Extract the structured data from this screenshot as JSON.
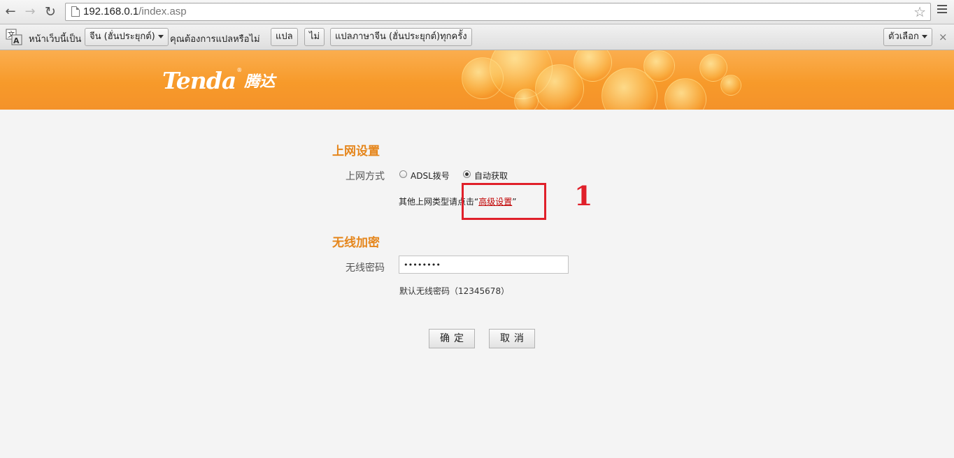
{
  "browser": {
    "url_host": "192.168.0.1",
    "url_path": "/index.asp",
    "icons": {
      "back": "back-arrow-icon",
      "forward": "forward-arrow-icon",
      "reload": "reload-icon",
      "bookmark": "star-icon",
      "menu": "menu-icon"
    }
  },
  "translate_bar": {
    "prefix": "หน้าเว็บนี้เป็น",
    "language_select": "จีน (ฮั่นประยุกต์)",
    "question": "คุณต้องการแปลหรือไม่",
    "translate_button": "แปล",
    "no_button": "ไม่",
    "always_button": "แปลภาษาจีน (ฮั่นประยุกต์)ทุกครั้ง",
    "options_button": "ตัวเลือก",
    "close_icon": "×"
  },
  "banner": {
    "brand_en": "Tenda",
    "brand_reg": "®",
    "brand_cn": "腾达",
    "colors": {
      "primary": "#f79a2a",
      "highlight": "#fbae4f"
    }
  },
  "internet": {
    "title": "上网设置",
    "mode_label": "上网方式",
    "options": [
      {
        "label": "ADSL拨号",
        "selected": false
      },
      {
        "label": "自动获取",
        "selected": true
      }
    ],
    "other_prefix": "其他上网类型请点击“",
    "advanced_link": "高级设置",
    "other_suffix": "”"
  },
  "annotation": {
    "step_number": "1",
    "color": "#e0202a"
  },
  "wireless": {
    "title": "无线加密",
    "password_label": "无线密码",
    "password_value": "••••••••",
    "hint": "默认无线密码（12345678）"
  },
  "buttons": {
    "confirm": "确定",
    "cancel": "取消"
  }
}
